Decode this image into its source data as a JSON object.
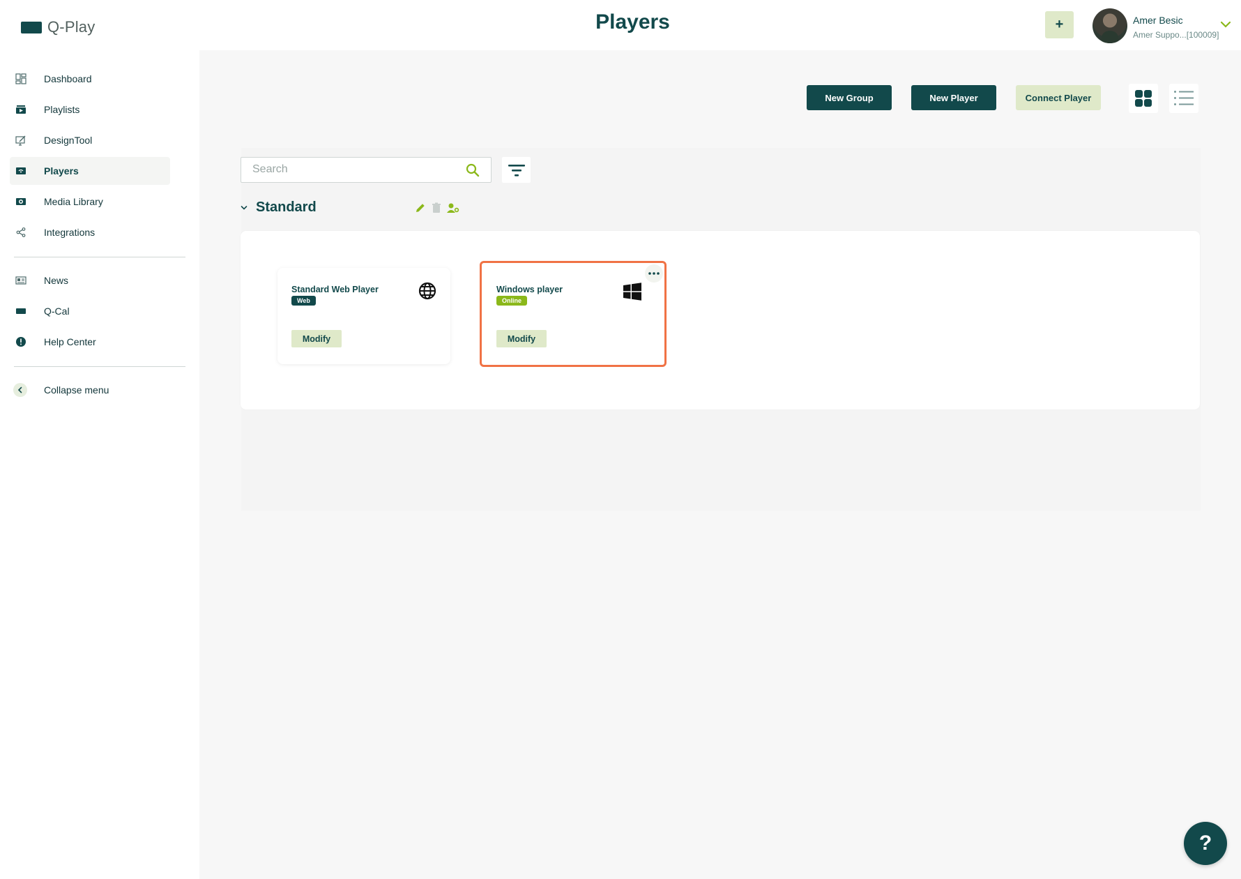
{
  "app": {
    "logo_text": "Q-Play",
    "page_title": "Players"
  },
  "header": {
    "add_label": "+",
    "user": {
      "name": "Amer Besic",
      "subtitle": "Amer Suppo...[100009]"
    }
  },
  "sidebar": {
    "items": [
      {
        "label": "Dashboard",
        "icon": "dashboard-icon"
      },
      {
        "label": "Playlists",
        "icon": "playlist-icon"
      },
      {
        "label": "DesignTool",
        "icon": "design-icon"
      },
      {
        "label": "Players",
        "icon": "player-icon",
        "active": true
      },
      {
        "label": "Media Library",
        "icon": "media-icon"
      },
      {
        "label": "Integrations",
        "icon": "share-icon"
      }
    ],
    "secondary": [
      {
        "label": "News",
        "icon": "news-icon"
      },
      {
        "label": "Q-Cal",
        "icon": "calendar-icon"
      },
      {
        "label": "Help Center",
        "icon": "info-icon"
      }
    ],
    "collapse_label": "Collapse menu"
  },
  "toolbar": {
    "new_group": "New Group",
    "new_player": "New Player",
    "connect_player": "Connect Player",
    "view_mode": "grid"
  },
  "search": {
    "placeholder": "Search",
    "value": ""
  },
  "group": {
    "title": "Standard",
    "players": [
      {
        "name": "Standard Web Player",
        "badge": "Web",
        "type_icon": "globe-icon",
        "modify_label": "Modify"
      },
      {
        "name": "Windows player",
        "badge": "Online",
        "type_icon": "windows-icon",
        "modify_label": "Modify",
        "selected": true
      }
    ]
  },
  "help_fab": "?",
  "colors": {
    "primary": "#12494b",
    "accent_green": "#8bb81a",
    "light_green": "#dfe9c9",
    "selection": "#f07245"
  }
}
